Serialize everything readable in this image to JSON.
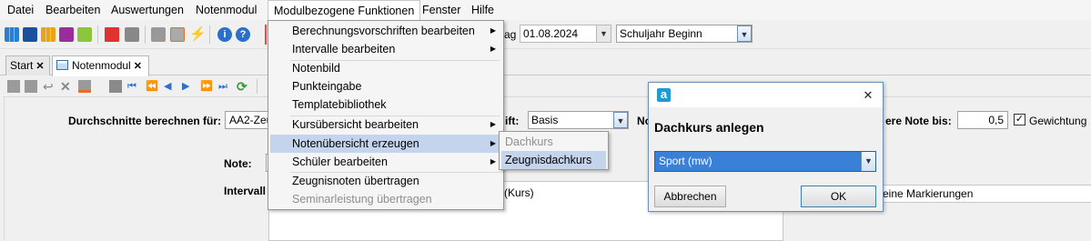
{
  "menubar": {
    "items": [
      "Datei",
      "Bearbeiten",
      "Auswertungen",
      "Notenmodul",
      "Modulbezogene Funktionen",
      "Fenster",
      "Hilfe"
    ]
  },
  "toolbar": {
    "date_label_fragment": "ag",
    "date_value": "01.08.2024",
    "period_value": "Schuljahr Beginn"
  },
  "tabs": {
    "start": "Start",
    "notenmodul": "Notenmodul"
  },
  "form": {
    "averages_label": "Durchschnitte berechnen für:",
    "averages_value": "AA2-Zeu",
    "schrift_label_fragment": "ift:",
    "schrift_value": "Basis",
    "no_label_fragment": "No",
    "note_bis_label": "ere Note bis:",
    "note_bis_value": "0,5",
    "weighting_label": "Gewichtung",
    "weighting_checked": true,
    "note_label": "Note:",
    "intervall_label": "Intervall",
    "kurs_text": "(Kurs)",
    "markierungen_value": "eine Markierungen"
  },
  "dropdown_menu": {
    "items": [
      {
        "label": "Berechnungsvorschriften bearbeiten",
        "submenu": true
      },
      {
        "label": "Intervalle bearbeiten",
        "submenu": true
      },
      {
        "label": "Notenbild"
      },
      {
        "label": "Punkteingabe"
      },
      {
        "label": "Templatebibliothek"
      },
      {
        "label": "Kursübersicht bearbeiten",
        "submenu": true
      },
      {
        "label": "Notenübersicht erzeugen",
        "submenu": true,
        "highlighted": true
      },
      {
        "label": "Schüler bearbeiten",
        "submenu": true
      },
      {
        "label": "Zeugnisnoten übertragen"
      },
      {
        "label": "Seminarleistung übertragen",
        "disabled": true
      }
    ]
  },
  "submenu": {
    "items": [
      {
        "label": "Dachkurs",
        "disabled": true
      },
      {
        "label": "Zeugnisdachkurs",
        "highlighted": true
      }
    ]
  },
  "dialog": {
    "logo_letter": "a",
    "close_glyph": "✕",
    "heading": "Dachkurs anlegen",
    "selected_value": "Sport (mw)",
    "cancel_label": "Abbrechen",
    "ok_label": "OK"
  },
  "colors": {
    "menu_highlight": "#c4d4ec",
    "selection_blue": "#3a80d8",
    "dialog_logo": "#1e9bd7",
    "toolbar_red_sep": "#e24c4c"
  }
}
